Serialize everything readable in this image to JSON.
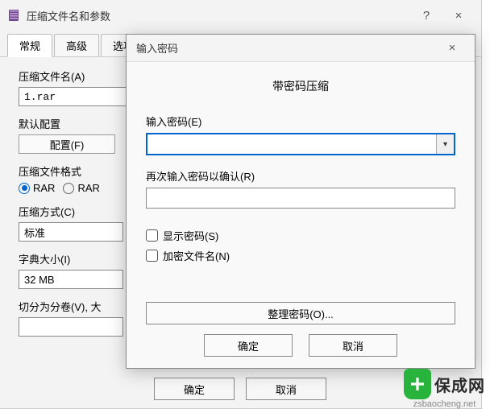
{
  "parent": {
    "title": "压缩文件名和参数",
    "help_icon": "?",
    "close_icon": "×",
    "tabs": [
      "常规",
      "高级",
      "选项"
    ],
    "archive_name_label": "压缩文件名(A)",
    "archive_name_value": "1.rar",
    "default_profile_label": "默认配置",
    "profile_button": "配置(F)",
    "format_label": "压缩文件格式",
    "format_options": {
      "rar": "RAR",
      "rar4": "RAR"
    },
    "method_label": "压缩方式(C)",
    "method_value": "标准",
    "dict_label": "字典大小(I)",
    "dict_value": "32 MB",
    "split_label": "切分为分卷(V), 大",
    "split_value": "",
    "ok": "确定",
    "cancel": "取消"
  },
  "modal": {
    "title": "输入密码",
    "close_icon": "×",
    "header": "带密码压缩",
    "pw_label": "输入密码(E)",
    "pw_value": "",
    "pw_confirm_label": "再次输入密码以确认(R)",
    "pw_confirm_value": "",
    "show_pw_label": "显示密码(S)",
    "encrypt_names_label": "加密文件名(N)",
    "organize_label": "整理密码(O)...",
    "ok": "确定",
    "cancel": "取消",
    "dropdown_arrow": "▾"
  },
  "watermark": {
    "brand": "保成网",
    "domain": "zsbaocheng.net"
  }
}
